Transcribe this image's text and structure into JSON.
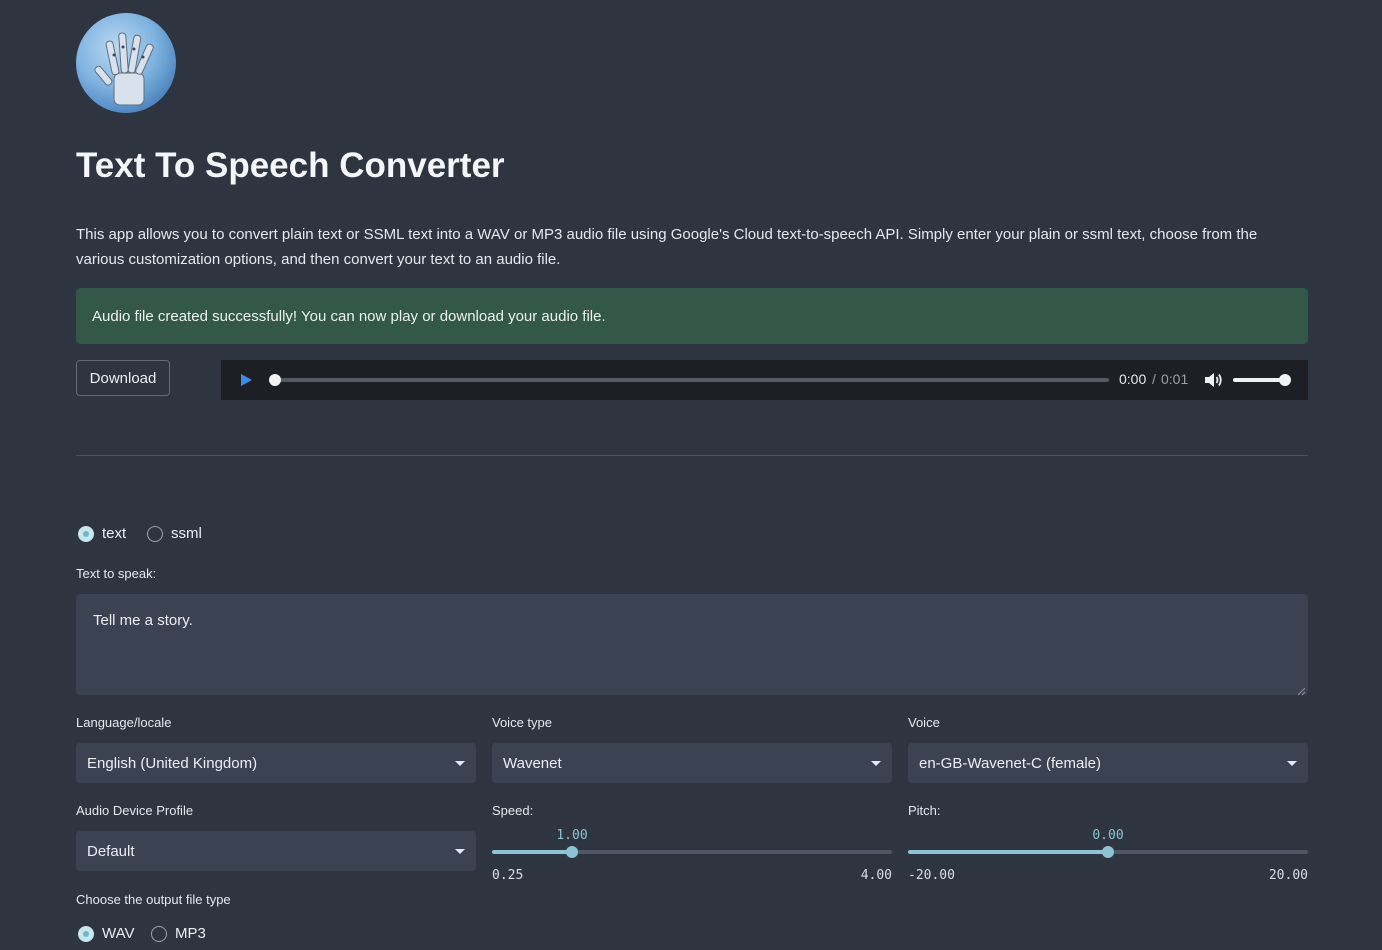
{
  "header": {
    "title": "Text To Speech Converter",
    "description": "This app allows you to convert plain text or SSML text into a WAV or MP3 audio file using Google's Cloud text-to-speech API. Simply enter your plain or ssml text, choose from the various customization options, and then convert your text to an audio file."
  },
  "alert": {
    "message": "Audio file created successfully! You can now play or download your audio file.",
    "color": "#33584a"
  },
  "download": {
    "label": "Download"
  },
  "player": {
    "current_time": "0:00",
    "separator": "/",
    "duration": "0:01",
    "progress": 0.0,
    "volume": 1.0,
    "play_color": "#3b8ee8"
  },
  "input_mode": {
    "options": [
      {
        "label": "text",
        "selected": true
      },
      {
        "label": "ssml",
        "selected": false
      }
    ]
  },
  "text_input": {
    "label": "Text to speak:",
    "value": "Tell me a story."
  },
  "language": {
    "label": "Language/locale",
    "value": "English (United Kingdom)"
  },
  "voice_type": {
    "label": "Voice type",
    "value": "Wavenet"
  },
  "voice": {
    "label": "Voice",
    "value": "en-GB-Wavenet-C (female)"
  },
  "device_profile": {
    "label": "Audio Device Profile",
    "value": "Default"
  },
  "speed": {
    "label": "Speed:",
    "value": 1.0,
    "value_text": "1.00",
    "min": 0.25,
    "max": 4.0,
    "min_text": "0.25",
    "max_text": "4.00"
  },
  "pitch": {
    "label": "Pitch:",
    "value": 0.0,
    "value_text": "0.00",
    "min": -20.0,
    "max": 20.0,
    "min_text": "-20.00",
    "max_text": "20.00"
  },
  "output_type": {
    "label": "Choose the output file type",
    "options": [
      {
        "label": "WAV",
        "selected": true
      },
      {
        "label": "MP3",
        "selected": false
      }
    ]
  },
  "accent_color": "#8cc4d4"
}
